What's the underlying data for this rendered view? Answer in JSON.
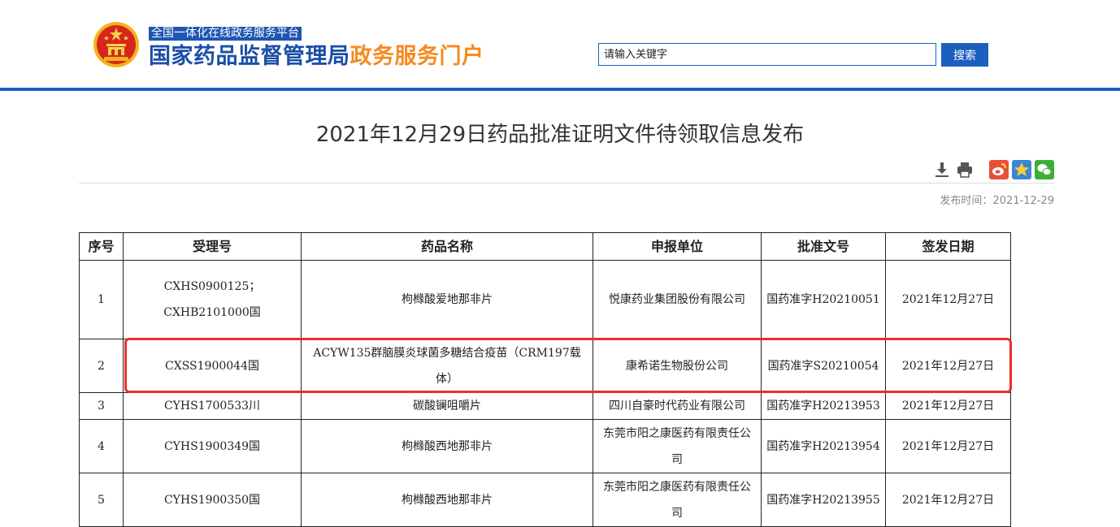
{
  "header": {
    "platform_tag": "全国一体化在线政务服务平台",
    "site_name_blue": "国家药品监督管理局",
    "site_name_orange": "政务服务门户",
    "search": {
      "placeholder": "请输入关键字",
      "button_label": "搜索"
    }
  },
  "article": {
    "title": "2021年12月29日药品批准证明文件待领取信息发布",
    "publish_label": "发布时间：",
    "publish_date": "2021-12-29"
  },
  "toolbar": {
    "icons": [
      "download-icon",
      "print-icon",
      "weibo-icon",
      "qzone-icon",
      "wechat-icon"
    ]
  },
  "table": {
    "headers": [
      "序号",
      "受理号",
      "药品名称",
      "申报单位",
      "批准文号",
      "签发日期"
    ],
    "rows": [
      {
        "no": "1",
        "acceptance": "CXHS0900125；CXHB2101000国",
        "drug": "枸橼酸爱地那非片",
        "company": "悦康药业集团股份有限公司",
        "approval": "国药准字H20210051",
        "date": "2021年12月27日"
      },
      {
        "no": "2",
        "acceptance": "CXSS1900044国",
        "drug": "ACYW135群脑膜炎球菌多糖结合疫苗（CRM197载体）",
        "company": "康希诺生物股份公司",
        "approval": "国药准字S20210054",
        "date": "2021年12月27日"
      },
      {
        "no": "3",
        "acceptance": "CYHS1700533川",
        "drug": "碳酸镧咀嚼片",
        "company": "四川自豪时代药业有限公司",
        "approval": "国药准字H20213953",
        "date": "2021年12月27日"
      },
      {
        "no": "4",
        "acceptance": "CYHS1900349国",
        "drug": "枸橼酸西地那非片",
        "company": "东莞市阳之康医药有限责任公司",
        "approval": "国药准字H20213954",
        "date": "2021年12月27日"
      },
      {
        "no": "5",
        "acceptance": "CYHS1900350国",
        "drug": "枸橼酸西地那非片",
        "company": "东莞市阳之康医药有限责任公司",
        "approval": "国药准字H20213955",
        "date": "2021年12月27日"
      }
    ]
  },
  "colors": {
    "brand_blue": "#1d5fbf",
    "brand_orange": "#f58a1f",
    "highlight_red": "#e8302a"
  }
}
